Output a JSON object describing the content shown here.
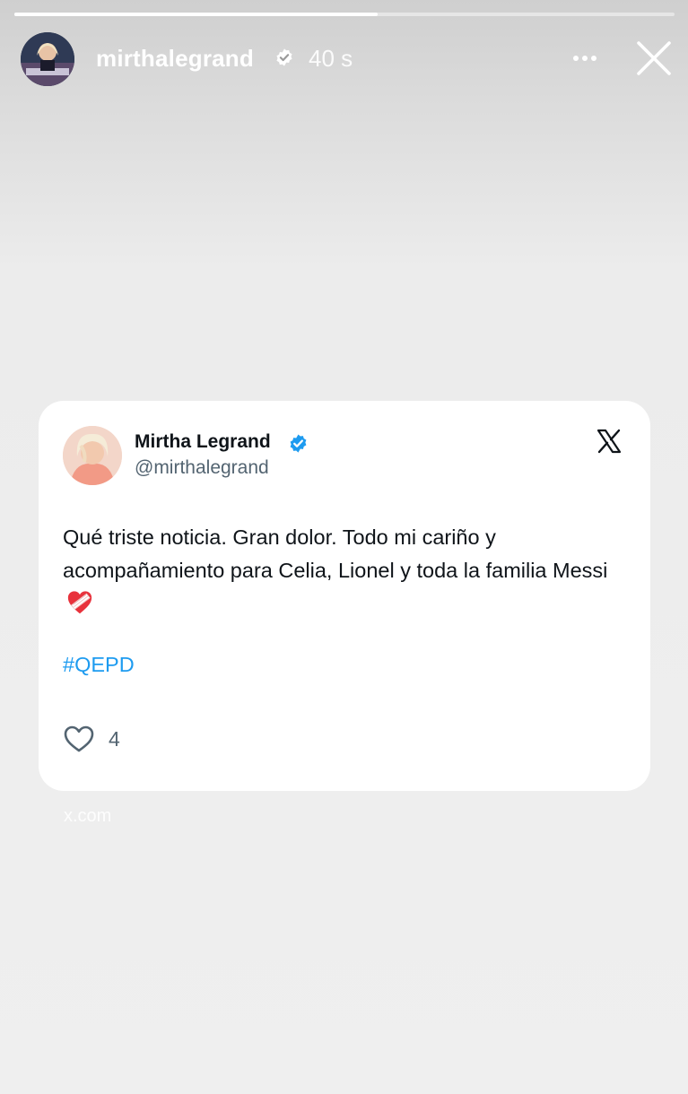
{
  "story": {
    "progress": 0.55,
    "username": "mirthalegrand",
    "time": "40 s",
    "more_label": "•••"
  },
  "tweet": {
    "display_name": "Mirtha Legrand",
    "handle": "@mirthalegrand",
    "text": "Qué triste noticia. Gran dolor. Todo mi cariño y acompañamiento para Celia, Lionel y toda la familia Messi",
    "emoji": "heart-with-bandage",
    "hashtag": "#QEPD",
    "likes": "4"
  },
  "link": {
    "source": "x.com"
  },
  "colors": {
    "verified": "#1d9bf0",
    "hashtag": "#1d9bf0",
    "text": "#0f1419",
    "muted": "#536471"
  },
  "icons": [
    "verified-badge-icon",
    "more-icon",
    "close-icon",
    "x-logo-icon",
    "heart-icon",
    "heart-with-bandage-emoji"
  ]
}
